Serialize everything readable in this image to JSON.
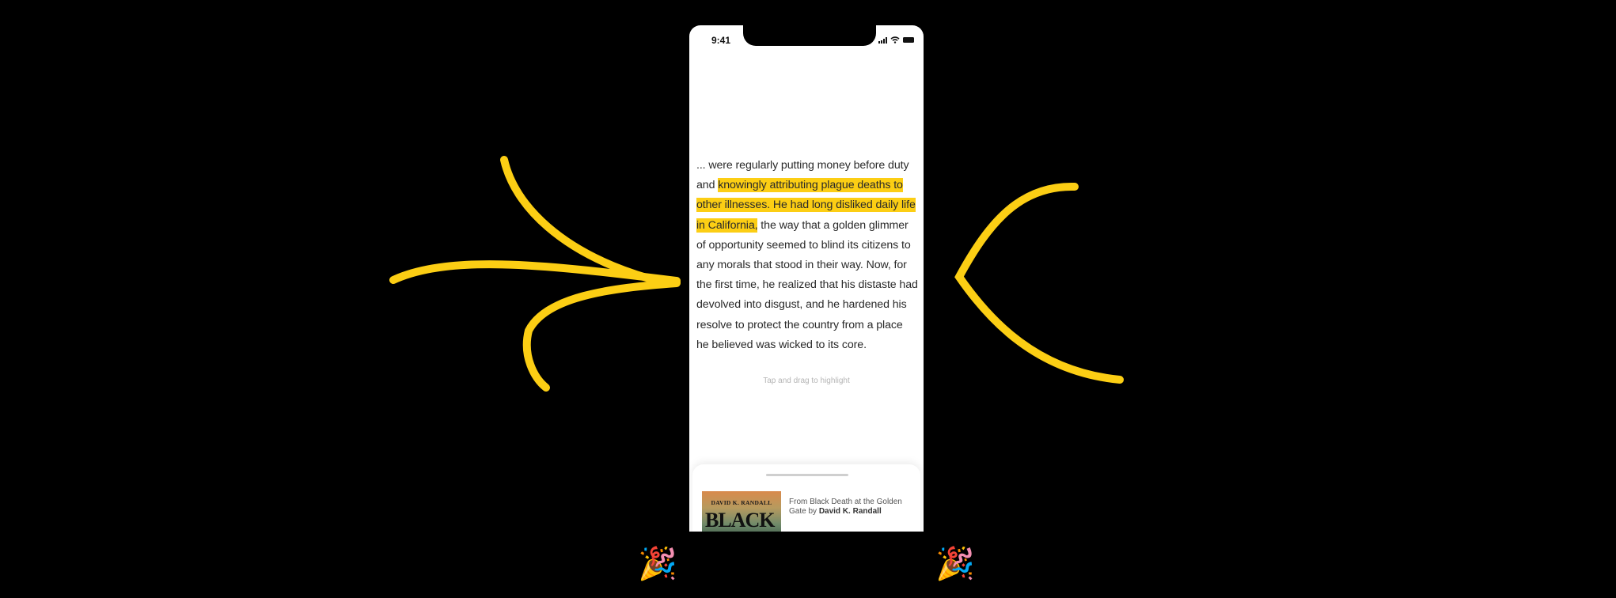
{
  "status_bar": {
    "time": "9:41"
  },
  "passage": {
    "lead": "... were regularly putting money before duty and ",
    "highlight": "knowingly attributing plague deaths to other illnesses. He had long disliked daily life in California,",
    "tail": " the way that a golden glimmer of opportunity seemed to blind its citizens to any morals that stood in their way. Now, for the first time, he realized that his distaste had devolved into disgust, and he hardened his resolve to protect the country from a place he believed was wicked to its core."
  },
  "hint": "Tap and drag to highlight",
  "book": {
    "source_prefix": "From Black Death at the Golden Gate by ",
    "author": "David K. Randall",
    "cover_author": "DAVID K. RANDALL",
    "cover_title": "BLACK"
  },
  "decorations": {
    "emoji": "🎉"
  },
  "colors": {
    "highlight": "#fcce14",
    "arrows": "#fcce14",
    "background": "#000000"
  }
}
